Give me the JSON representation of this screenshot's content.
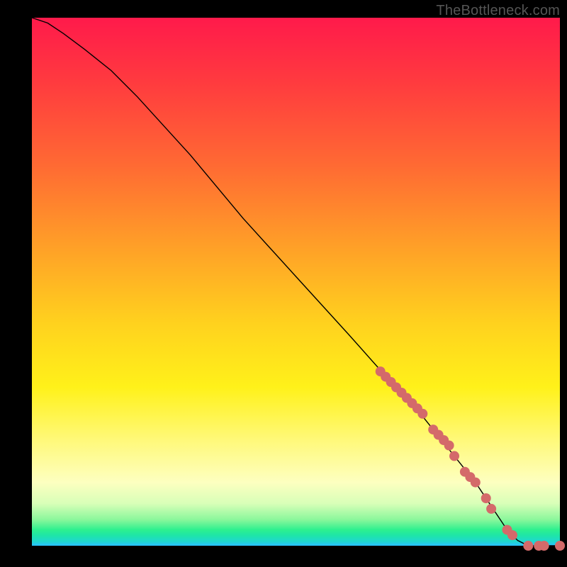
{
  "watermark": "TheBottleneck.com",
  "colors": {
    "dot": "#d46a6a",
    "curve": "#000000",
    "frame": "#000000"
  },
  "chart_data": {
    "type": "line",
    "title": "",
    "xlabel": "",
    "ylabel": "",
    "xlim": [
      0,
      100
    ],
    "ylim": [
      0,
      100
    ],
    "grid": false,
    "legend": null,
    "series": [
      {
        "name": "bottleneck-curve",
        "x": [
          0,
          3,
          6,
          10,
          15,
          20,
          30,
          40,
          50,
          60,
          68,
          72,
          76,
          80,
          84,
          88,
          90,
          92,
          94,
          96,
          98,
          100
        ],
        "y": [
          100,
          99,
          97,
          94,
          90,
          85,
          74,
          62,
          51,
          40,
          31,
          27,
          22,
          17,
          12,
          6,
          3,
          1,
          0,
          0,
          0,
          0
        ]
      }
    ],
    "highlight_points": {
      "name": "highlighted-samples",
      "x": [
        66,
        67,
        68,
        69,
        70,
        71,
        72,
        73,
        74,
        76,
        77,
        78,
        79,
        80,
        82,
        83,
        84,
        86,
        87,
        90,
        91,
        94,
        96,
        97,
        100
      ],
      "y": [
        33,
        32,
        31,
        30,
        29,
        28,
        27,
        26,
        25,
        22,
        21,
        20,
        19,
        17,
        14,
        13,
        12,
        9,
        7,
        3,
        2,
        0,
        0,
        0,
        0
      ]
    }
  }
}
